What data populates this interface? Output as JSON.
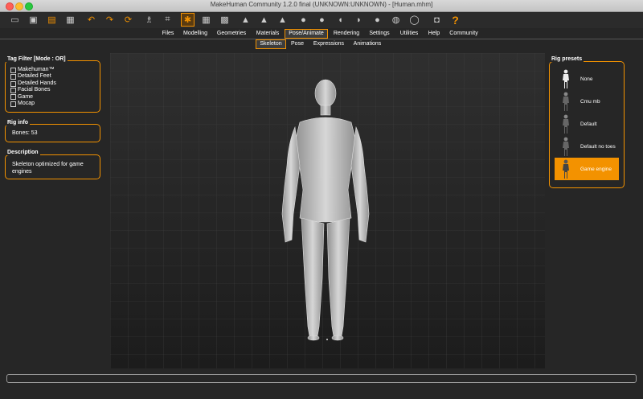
{
  "window": {
    "title": "MakeHuman Community 1.2.0 final (UNKNOWN:UNKNOWN) - [Human.mhm]"
  },
  "toolbar": {
    "icons": [
      "new-icon",
      "save-icon",
      "load-icon",
      "export-icon",
      "undo-icon",
      "redo-icon",
      "reset-icon",
      "smooth-icon",
      "wireframe-icon",
      "skeleton-icon",
      "grid-icon",
      "checker-icon",
      "front-view-icon",
      "side-view-icon",
      "back-view-icon",
      "head-view-icon",
      "face-view-icon",
      "left-view-icon",
      "right-view-icon",
      "top-view-icon",
      "bottom-view-icon",
      "reset-camera-icon",
      "screenshot-icon",
      "help-icon"
    ],
    "help_label": "?"
  },
  "main_tabs": [
    "Files",
    "Modelling",
    "Geometries",
    "Materials",
    "Pose/Animate",
    "Rendering",
    "Settings",
    "Utilities",
    "Help",
    "Community"
  ],
  "main_tab_active": "Pose/Animate",
  "sub_tabs": [
    "Skeleton",
    "Pose",
    "Expressions",
    "Animations"
  ],
  "sub_tab_active": "Skeleton",
  "tag_filter": {
    "title": "Tag Filter [Mode : OR]",
    "items": [
      "Makehuman™",
      "Detailed Feet",
      "Detailed Hands",
      "Facial Bones",
      "Game",
      "Mocap"
    ]
  },
  "rig_info": {
    "title": "Rig info",
    "bones": "Bones: 53"
  },
  "description": {
    "title": "Description",
    "text": "Skeleton optimized for game engines"
  },
  "rig_presets": {
    "title": "Rig presets",
    "items": [
      "None",
      "Cmu mb",
      "Default",
      "Default no toes",
      "Game engine"
    ],
    "selected": "Game engine"
  },
  "colors": {
    "accent": "#f39200",
    "background": "#262626"
  }
}
